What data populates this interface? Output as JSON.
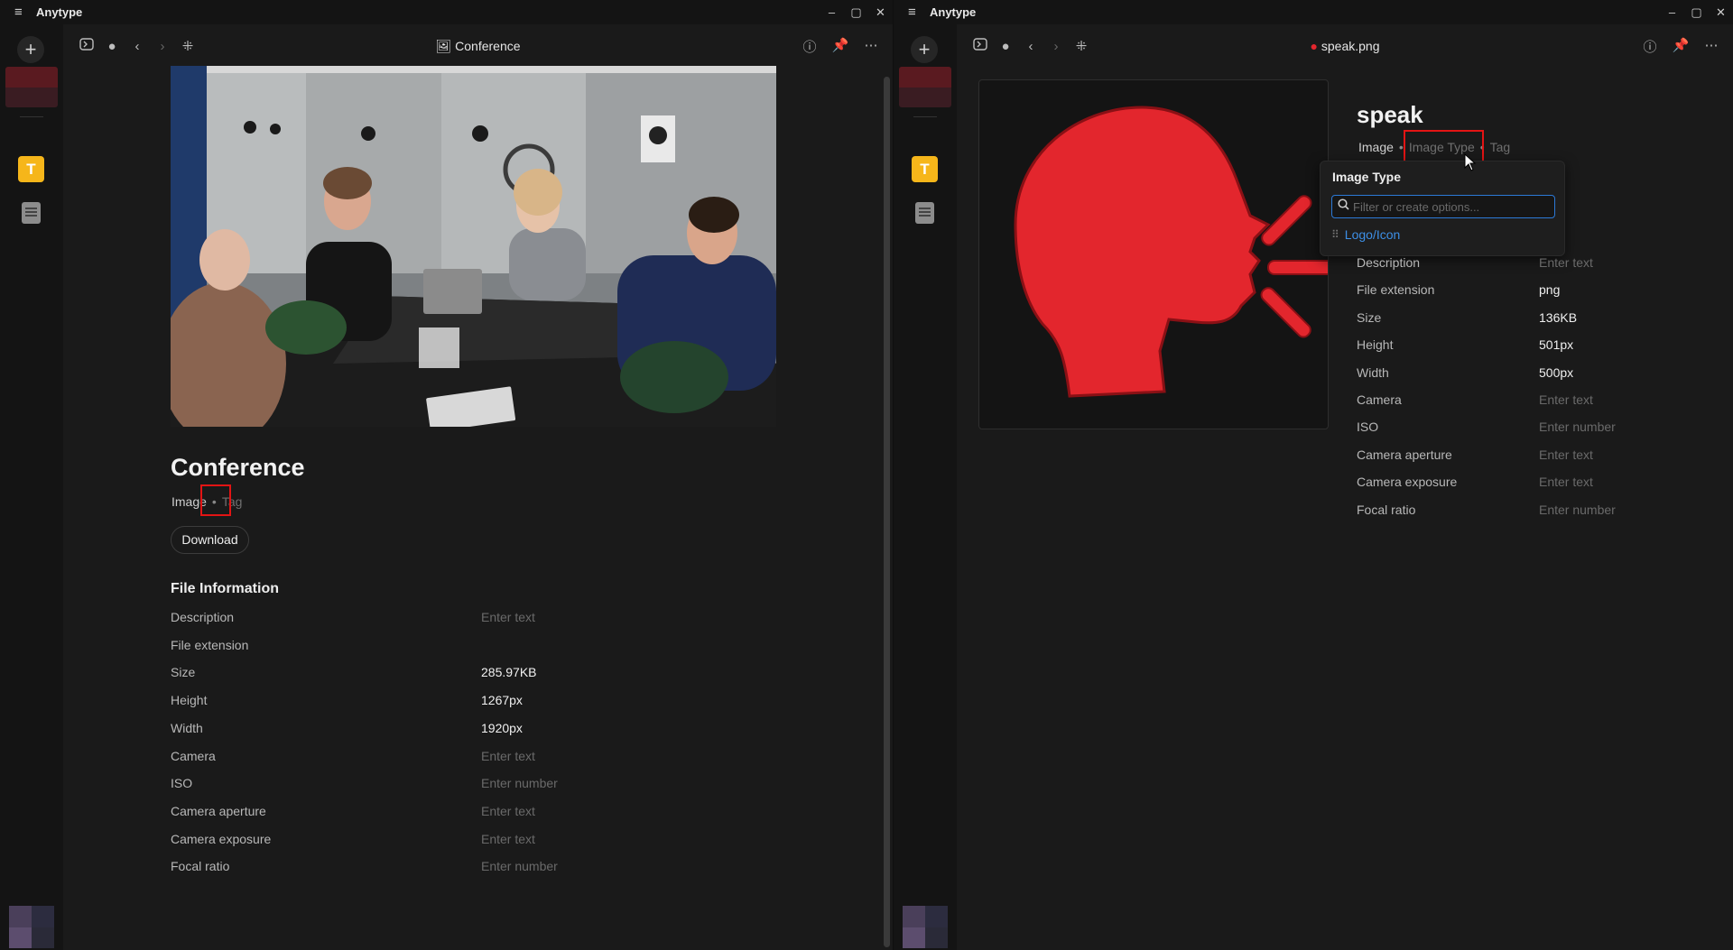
{
  "left": {
    "app_title": "Anytype",
    "header_title": "Conference",
    "object_title": "Conference",
    "relations": {
      "type": "Image",
      "tag": "Tag"
    },
    "download_label": "Download",
    "section_title": "File Information",
    "properties": [
      {
        "key": "Description",
        "value": "Enter text",
        "placeholder": true
      },
      {
        "key": "File extension",
        "value": "",
        "placeholder": false
      },
      {
        "key": "Size",
        "value": "285.97KB",
        "placeholder": false
      },
      {
        "key": "Height",
        "value": "1267px",
        "placeholder": false
      },
      {
        "key": "Width",
        "value": "1920px",
        "placeholder": false
      },
      {
        "key": "Camera",
        "value": "Enter text",
        "placeholder": true
      },
      {
        "key": "ISO",
        "value": "Enter number",
        "placeholder": true
      },
      {
        "key": "Camera aperture",
        "value": "Enter text",
        "placeholder": true
      },
      {
        "key": "Camera exposure",
        "value": "Enter text",
        "placeholder": true
      },
      {
        "key": "Focal ratio",
        "value": "Enter number",
        "placeholder": true
      }
    ]
  },
  "right": {
    "app_title": "Anytype",
    "header_title": "speak.png",
    "object_title": "speak",
    "relations": {
      "type": "Image",
      "image_type": "Image Type",
      "tag": "Tag"
    },
    "dropdown": {
      "title": "Image Type",
      "placeholder": "Filter or create options...",
      "options": [
        "Logo/Icon"
      ]
    },
    "properties": [
      {
        "key": "Description",
        "value": "Enter text",
        "placeholder": true
      },
      {
        "key": "File extension",
        "value": "png",
        "placeholder": false
      },
      {
        "key": "Size",
        "value": "136KB",
        "placeholder": false
      },
      {
        "key": "Height",
        "value": "501px",
        "placeholder": false
      },
      {
        "key": "Width",
        "value": "500px",
        "placeholder": false
      },
      {
        "key": "Camera",
        "value": "Enter text",
        "placeholder": true
      },
      {
        "key": "ISO",
        "value": "Enter number",
        "placeholder": true
      },
      {
        "key": "Camera aperture",
        "value": "Enter text",
        "placeholder": true
      },
      {
        "key": "Camera exposure",
        "value": "Enter text",
        "placeholder": true
      },
      {
        "key": "Focal ratio",
        "value": "Enter number",
        "placeholder": true
      }
    ]
  },
  "icons": {
    "menu": "menu-icon",
    "add": "plus-icon",
    "sidebar_toggle": "sidebar-toggle-icon",
    "back": "chevron-left-icon",
    "forward": "chevron-right-icon",
    "graph": "graph-icon",
    "info": "info-icon",
    "pin": "pin-icon",
    "more": "more-icon",
    "search": "search-icon"
  },
  "colors": {
    "accent_yellow": "#f6b61a",
    "link_blue": "#3d8fe6",
    "highlight_red": "#e31414",
    "speak_icon_red": "#e3262d"
  }
}
